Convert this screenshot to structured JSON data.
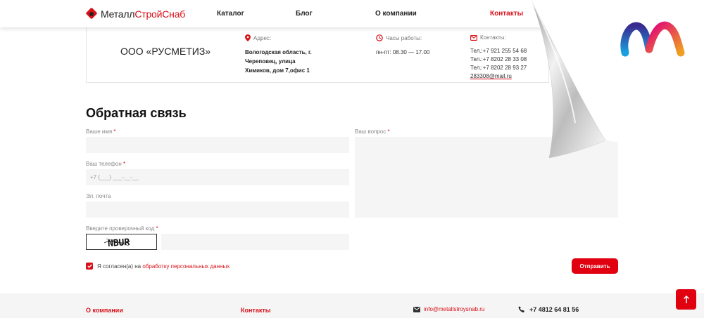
{
  "logo": {
    "part1": "Металл",
    "part2": "Строй",
    "part3": "Снаб"
  },
  "nav": [
    {
      "label": "Каталог"
    },
    {
      "label": "Блог"
    },
    {
      "label": "О компании"
    },
    {
      "label": "Контакты",
      "active": true
    }
  ],
  "info": {
    "company": "ООО «РУСМЕТИЗ»",
    "address_label": "Адрес:",
    "address_lines": [
      "Вологодская область, г.",
      "Череповец, улица",
      "Химиков, дом 7,офис 1"
    ],
    "hours_label": "Часы работы:",
    "hours": "пн-пт: 08.30 — 17.00",
    "contacts_label": "Контакты:",
    "contacts": [
      "Тел.:+7 921 255 54 68",
      "Тел.:+7 8202 28 33 08",
      "Тел.:+7 8202 28 93 27"
    ],
    "email": "283308@mail.ru"
  },
  "form": {
    "title": "Обратная связь",
    "name_label": "Ваше имя",
    "phone_label": "Ваш телефон",
    "phone_placeholder": "+7 (___) ___-__-__",
    "email_label": "Эл. почта",
    "captcha_label": "Введите проверочный код",
    "captcha_text": "NBUR",
    "question_label": "Ваш вопрос",
    "required_mark": "*",
    "agree_text": "Я согласен(а) на",
    "agree_link": "обработку персональных данных",
    "submit": "Отправить"
  },
  "footer": {
    "about": "О компании",
    "contacts": "Контакты",
    "email": "info@metallstroysnab.ru",
    "phone": "+7 4812 64 81 56"
  },
  "colors": {
    "accent": "#d81018",
    "field_bg": "#f5f5f5",
    "footer_bg": "#f5f5f5"
  },
  "icons": [
    "map-pin-icon",
    "clock-icon",
    "envelope-icon",
    "phone-icon",
    "arrow-up-icon",
    "check-icon"
  ]
}
